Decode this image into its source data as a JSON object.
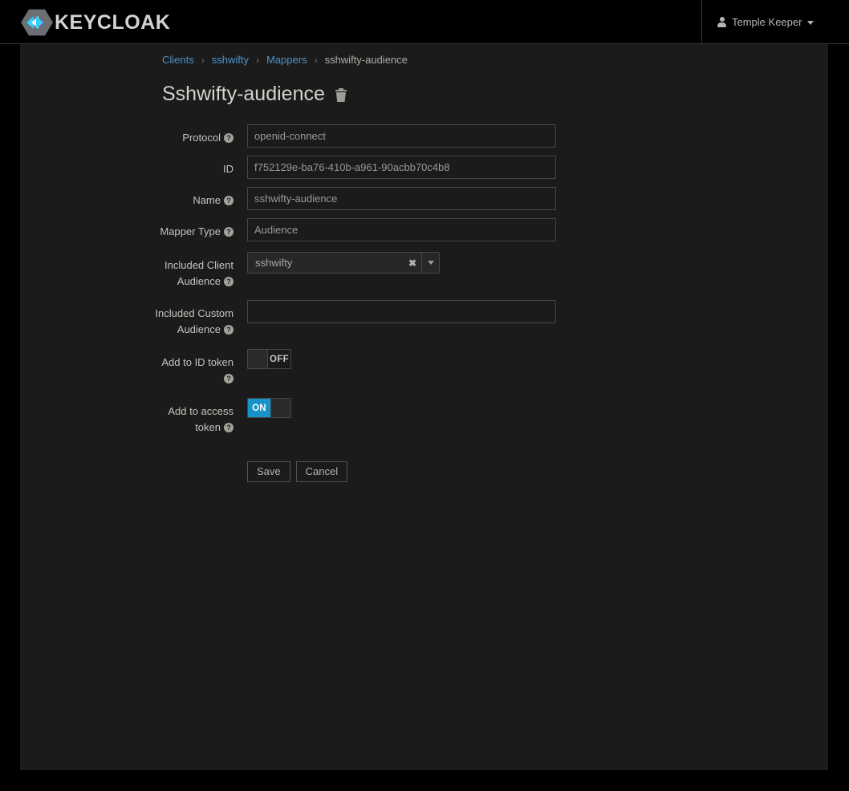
{
  "navbar": {
    "brand_name": "KEYCLOAK",
    "brand_icon": "keycloak-hexagon-logo",
    "user": {
      "icon": "user-icon",
      "name": "Temple Keeper",
      "caret_icon": "chevron-down-icon"
    }
  },
  "breadcrumb": {
    "items": [
      {
        "label": "Clients",
        "link": true
      },
      {
        "label": "sshwifty",
        "link": true
      },
      {
        "label": "Mappers",
        "link": true
      },
      {
        "label": "sshwifty-audience",
        "link": false
      }
    ],
    "separator": "›"
  },
  "page": {
    "title": "Sshwifty-audience",
    "delete_icon": "trash-icon"
  },
  "form": {
    "help_glyph": "?",
    "fields": [
      {
        "label": "Protocol",
        "help": true,
        "type": "text",
        "value": "openid-connect",
        "name": "protocol"
      },
      {
        "label": "ID",
        "help": false,
        "type": "text",
        "value": "f752129e-ba76-410b-a961-90acbb70c4b8",
        "name": "id"
      },
      {
        "label": "Name",
        "help": true,
        "type": "text",
        "value": "sshwifty-audience",
        "name": "name"
      },
      {
        "label": "Mapper Type",
        "help": true,
        "type": "text",
        "value": "Audience",
        "name": "mapper-type"
      }
    ],
    "included_client_audience": {
      "label_line1": "Included Client",
      "label_line2": "Audience",
      "value": "sshwifty",
      "clear_glyph": "✖",
      "arrow_icon": "caret-down-icon"
    },
    "included_custom_audience": {
      "label_line1": "Included Custom",
      "label_line2": "Audience",
      "value": "",
      "placeholder": ""
    },
    "add_to_id_token": {
      "label": "Add to ID token",
      "state": "OFF",
      "on": false
    },
    "add_to_access_token": {
      "label_line1": "Add to access",
      "label_line2": "token",
      "state": "ON",
      "on": true
    },
    "save_label": "Save",
    "cancel_label": "Cancel"
  },
  "colors": {
    "accent_blue": "#1694c9",
    "link_blue": "#4c94c8",
    "logo_cyan": "#33ccff",
    "panel_bg": "#1b1b1b",
    "page_bg": "#000000"
  }
}
